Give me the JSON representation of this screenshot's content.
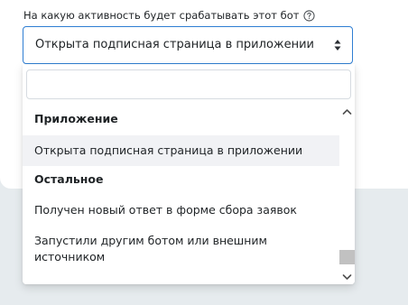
{
  "field": {
    "label": "На какую активность будет срабатывать этот бот",
    "help_icon": "question-circle-icon",
    "selected_value": "Открыта подписная страница в приложении",
    "dropdown_icon": "sort-arrows-icon",
    "accent_color": "#2f7ed3"
  },
  "dropdown": {
    "search_value": "",
    "search_placeholder": "",
    "groups": [
      {
        "title": "Приложение",
        "options": [
          {
            "label": "Открыта подписная страница в приложении",
            "highlighted": true
          }
        ]
      },
      {
        "title": "Остальное",
        "options": [
          {
            "label": "Получен новый ответ в форме сбора заявок",
            "highlighted": false
          },
          {
            "label": "Запустили другим ботом или внешним источником",
            "highlighted": false
          }
        ]
      }
    ],
    "scrollbar": {
      "up_icon": "chevron-up-icon",
      "down_icon": "chevron-down-icon"
    }
  }
}
